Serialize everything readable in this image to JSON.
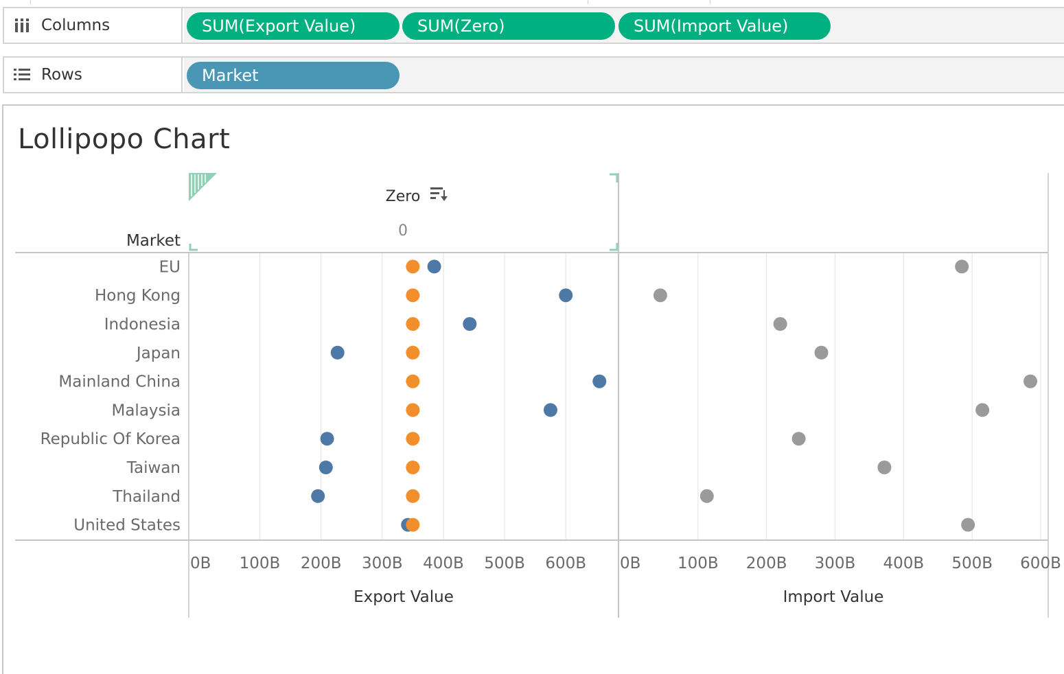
{
  "shelves": {
    "columns": {
      "label": "Columns",
      "icon": "columns-icon",
      "pills": [
        "SUM(Export Value)",
        "SUM(Zero)",
        "SUM(Import Value)"
      ]
    },
    "rows": {
      "label": "Rows",
      "icon": "rows-icon",
      "pills": [
        "Market"
      ]
    },
    "colors": {
      "measure_pill": "#00b080",
      "dimension_pill": "#4a97b5"
    }
  },
  "chart_data": {
    "type": "scatter",
    "title": "Lollipopo Chart",
    "row_header": "Market",
    "top_header": {
      "label": "Zero",
      "tick": "0",
      "sort_icon": "sort-descending-icon"
    },
    "categories": [
      "EU",
      "Hong Kong",
      "Indonesia",
      "Japan",
      "Mainland China",
      "Malaysia",
      "Republic Of Korea",
      "Taiwan",
      "Thailand",
      "United States"
    ],
    "series": [
      {
        "name": "Export Value",
        "panel": "left",
        "color": "#4e79a7",
        "values": [
          385,
          600,
          443,
          227,
          655,
          575,
          210,
          208,
          195,
          342
        ]
      },
      {
        "name": "Zero",
        "panel": "left",
        "color": "#f28e2b",
        "values": [
          350,
          350,
          350,
          350,
          350,
          350,
          350,
          350,
          350,
          350
        ]
      },
      {
        "name": "Import Value",
        "panel": "right",
        "color": "#9a9a9a",
        "values": [
          485,
          45,
          220,
          280,
          585,
          515,
          247,
          372,
          113,
          494
        ]
      }
    ],
    "panels": [
      {
        "xlabel": "Export Value",
        "xlim": [
          -15,
          685
        ],
        "ticks": [
          0,
          100,
          200,
          300,
          400,
          500,
          600
        ],
        "tick_labels": [
          "0B",
          "100B",
          "200B",
          "300B",
          "400B",
          "500B",
          "600B"
        ]
      },
      {
        "xlabel": "Import Value",
        "xlim": [
          -15,
          610
        ],
        "ticks": [
          0,
          100,
          200,
          300,
          400,
          500,
          600
        ],
        "tick_labels": [
          "0B",
          "100B",
          "200B",
          "300B",
          "400B",
          "500B",
          "600B"
        ]
      }
    ],
    "grid": true
  }
}
